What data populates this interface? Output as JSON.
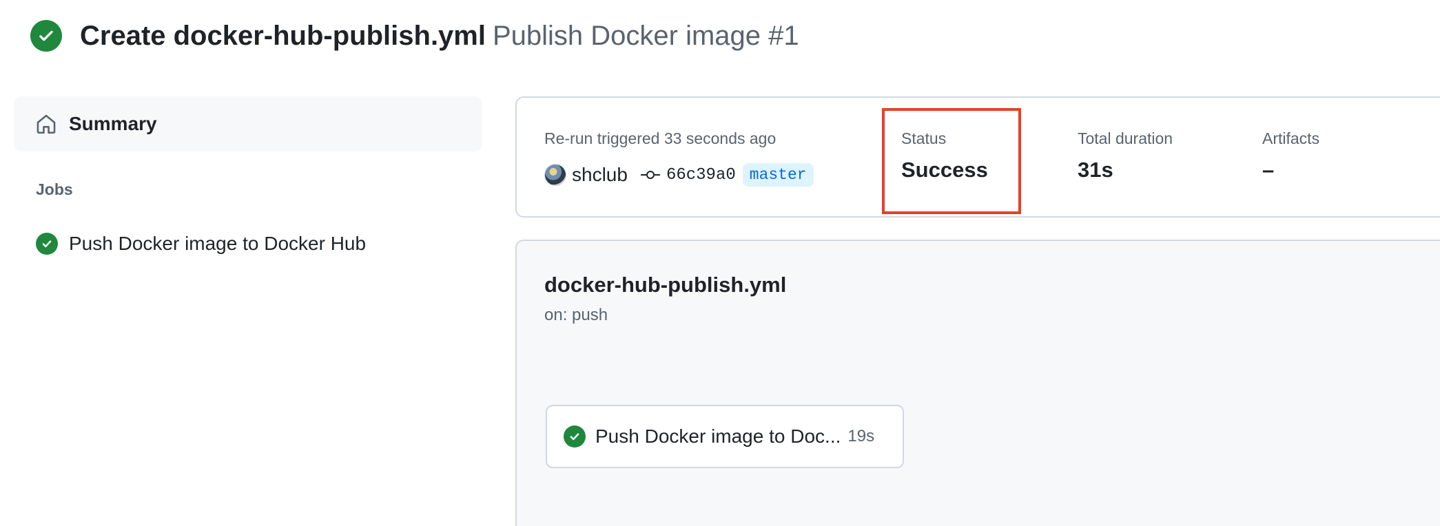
{
  "run": {
    "commit_title": "Create docker-hub-publish.yml",
    "workflow_run": "Publish Docker image #1",
    "status_color": "#1f883d"
  },
  "sidebar": {
    "summary_label": "Summary",
    "jobs_heading": "Jobs",
    "jobs": [
      {
        "label": "Push Docker image to Docker Hub",
        "status": "success"
      }
    ]
  },
  "summary": {
    "trigger_text": "Re-run triggered 33 seconds ago",
    "actor": "shclub",
    "commit_sha": "66c39a0",
    "branch": "master",
    "status_label": "Status",
    "status_value": "Success",
    "duration_label": "Total duration",
    "duration_value": "31s",
    "artifacts_label": "Artifacts",
    "artifacts_value": "–",
    "highlight_color": "#e4402a"
  },
  "workflow": {
    "file_name": "docker-hub-publish.yml",
    "trigger": "on: push",
    "jobs": [
      {
        "name": "Push Docker image to Doc...",
        "duration": "19s",
        "status": "success"
      }
    ]
  }
}
